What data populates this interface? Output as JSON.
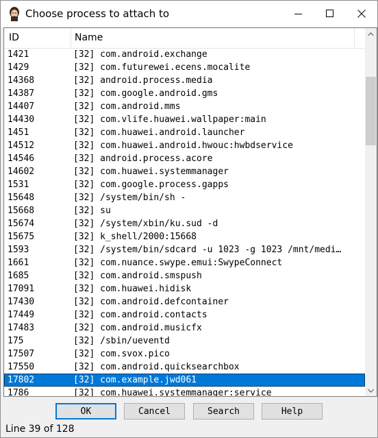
{
  "window": {
    "title": "Choose process to attach to",
    "controls": {
      "minimize": "minimize",
      "maximize": "maximize",
      "close": "close"
    }
  },
  "list": {
    "columns": {
      "id": "ID",
      "name": "Name"
    },
    "rows": [
      {
        "id": "1421",
        "name": "[32] com.android.exchange"
      },
      {
        "id": "1429",
        "name": "[32] com.futurewei.ecens.mocalite"
      },
      {
        "id": "14368",
        "name": "[32] android.process.media"
      },
      {
        "id": "14387",
        "name": "[32] com.google.android.gms"
      },
      {
        "id": "14407",
        "name": "[32] com.android.mms"
      },
      {
        "id": "14430",
        "name": "[32] com.vlife.huawei.wallpaper:main"
      },
      {
        "id": "1451",
        "name": "[32] com.huawei.android.launcher"
      },
      {
        "id": "14512",
        "name": "[32] com.huawei.android.hwouc:hwbdservice"
      },
      {
        "id": "14546",
        "name": "[32] android.process.acore"
      },
      {
        "id": "14602",
        "name": "[32] com.huawei.systemmanager"
      },
      {
        "id": "1531",
        "name": "[32] com.google.process.gapps"
      },
      {
        "id": "15648",
        "name": "[32] /system/bin/sh -"
      },
      {
        "id": "15668",
        "name": "[32] su"
      },
      {
        "id": "15674",
        "name": "[32] /system/xbin/ku.sud -d"
      },
      {
        "id": "15675",
        "name": "[32] k_shell/2000:15668"
      },
      {
        "id": "1593",
        "name": "[32] /system/bin/sdcard -u 1023 -g 1023 /mnt/medi…"
      },
      {
        "id": "1661",
        "name": "[32] com.nuance.swype.emui:SwypeConnect"
      },
      {
        "id": "1685",
        "name": "[32] com.android.smspush"
      },
      {
        "id": "17091",
        "name": "[32] com.huawei.hidisk"
      },
      {
        "id": "17430",
        "name": "[32] com.android.defcontainer"
      },
      {
        "id": "17449",
        "name": "[32] com.android.contacts"
      },
      {
        "id": "17483",
        "name": "[32] com.android.musicfx"
      },
      {
        "id": "175",
        "name": "[32] /sbin/ueventd"
      },
      {
        "id": "17507",
        "name": "[32] com.svox.pico"
      },
      {
        "id": "17550",
        "name": "[32] com.android.quicksearchbox"
      },
      {
        "id": "17802",
        "name": "[32] com.example.jwd061",
        "selected": true
      },
      {
        "id": "1786",
        "name": "[32] com.huawei.systemmanager:service"
      }
    ]
  },
  "buttons": {
    "ok": "OK",
    "cancel": "Cancel",
    "search": "Search",
    "help": "Help"
  },
  "status": {
    "text": "Line 39 of 128"
  },
  "colors": {
    "selection": "#0078d7",
    "button_face": "#e1e1e1",
    "default_border": "#0078d7"
  }
}
